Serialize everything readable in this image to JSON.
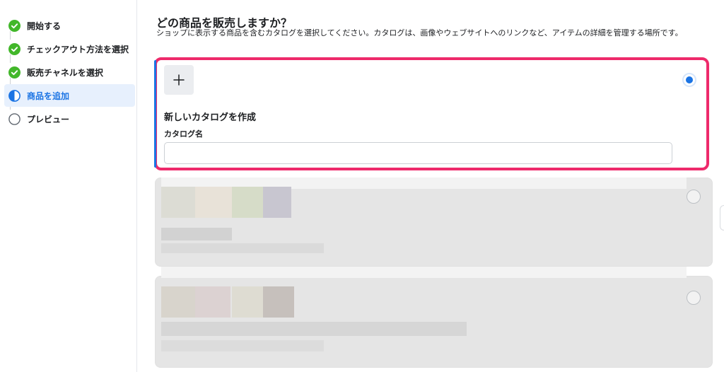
{
  "sidebar": {
    "steps": [
      {
        "label": "開始する",
        "state": "done"
      },
      {
        "label": "チェックアウト方法を選択",
        "state": "done"
      },
      {
        "label": "販売チャネルを選択",
        "state": "done"
      },
      {
        "label": "商品を追加",
        "state": "current"
      },
      {
        "label": "プレビュー",
        "state": "todo"
      }
    ]
  },
  "main": {
    "title": "どの商品を販売しますか？",
    "description": "ショップに表示する商品を含むカタログを選択してください。カタログは、画像やウェブサイトへのリンクなど、アイテムの詳細を管理する場所です。",
    "new_catalog": {
      "add_icon": "plus-icon",
      "title": "新しいカタログを作成",
      "name_label": "カタログ名",
      "name_value": "",
      "name_placeholder": "",
      "selected": true
    },
    "existing_catalogs": [
      {
        "selected": false,
        "content": "blurred"
      },
      {
        "selected": false,
        "content": "blurred"
      }
    ]
  },
  "colors": {
    "accent_blue": "#1b74e4",
    "done_green": "#42b72a",
    "highlight_pink": "#ee2a6b"
  }
}
